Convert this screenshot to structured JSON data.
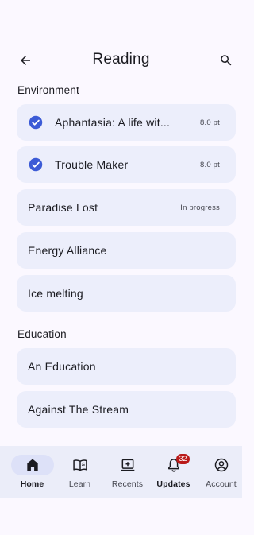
{
  "header": {
    "title": "Reading",
    "back_icon": "arrow-back-icon",
    "search_icon": "search-icon"
  },
  "sections": [
    {
      "title": "Environment",
      "items": [
        {
          "label": "Aphantasia: A life wit...",
          "trail": "8.0 pt",
          "checked": true
        },
        {
          "label": "Trouble Maker",
          "trail": "8.0 pt",
          "checked": true
        },
        {
          "label": "Paradise Lost",
          "trail": "In progress",
          "checked": false
        },
        {
          "label": "Energy Alliance",
          "trail": "",
          "checked": false
        },
        {
          "label": "Ice melting",
          "trail": "",
          "checked": false
        }
      ]
    },
    {
      "title": "Education",
      "items": [
        {
          "label": "An Education",
          "trail": "",
          "checked": false
        },
        {
          "label": "Against The Stream",
          "trail": "",
          "checked": false
        }
      ]
    }
  ],
  "nav": {
    "items": [
      {
        "label": "Home",
        "icon": "home-icon",
        "active": true
      },
      {
        "label": "Learn",
        "icon": "book-icon",
        "active": false
      },
      {
        "label": "Recents",
        "icon": "recents-icon",
        "active": false
      },
      {
        "label": "Updates",
        "icon": "notification-icon",
        "active": false,
        "badge": "32"
      },
      {
        "label": "Account",
        "icon": "account-icon",
        "active": false
      }
    ]
  },
  "colors": {
    "background": "#fbf8ff",
    "card": "#eceefb",
    "check": "#3c5bd6",
    "badge": "#ba1a1a",
    "nav_bg": "#ebedf9",
    "nav_active_pill": "#dde1f8"
  }
}
